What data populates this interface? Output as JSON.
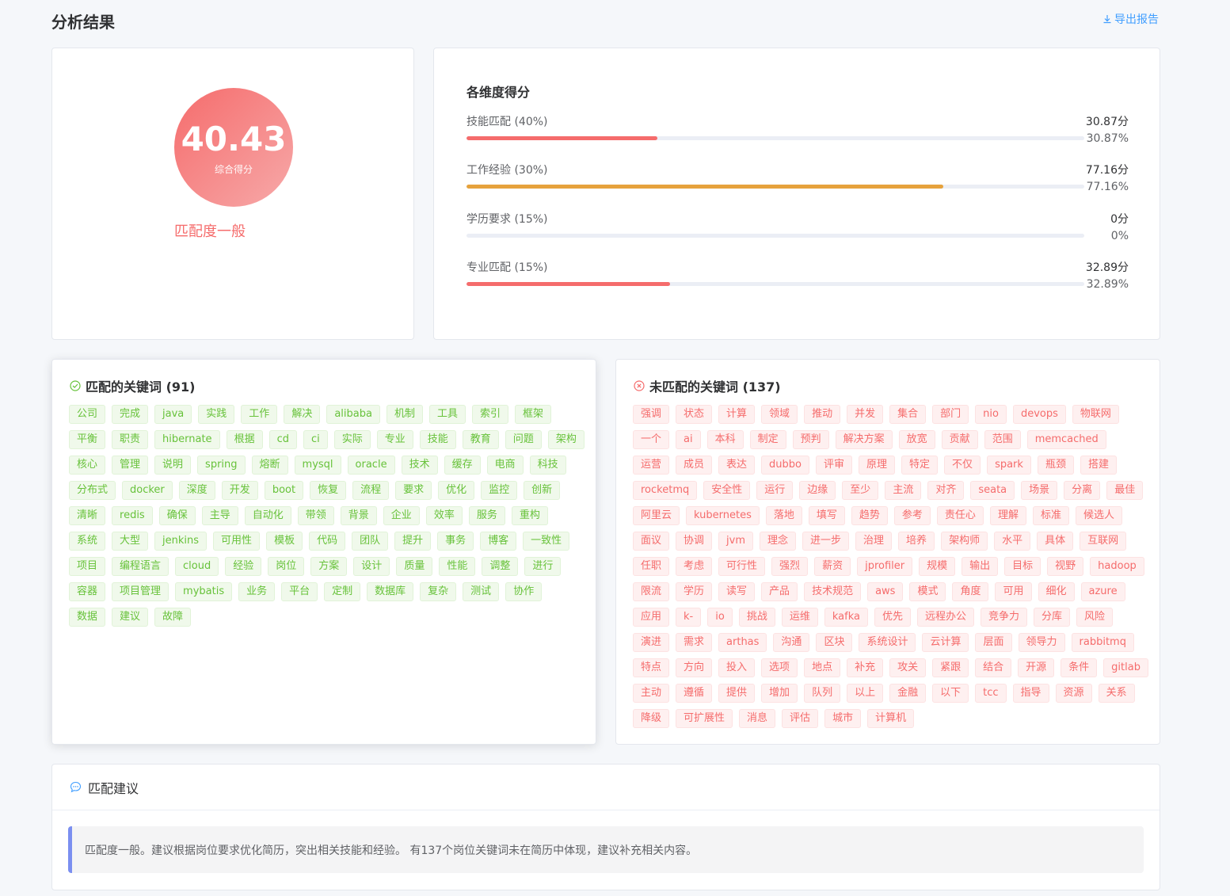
{
  "page": {
    "title": "分析结果",
    "export_label": "导出报告"
  },
  "score": {
    "value": "40.43",
    "label": "综合得分",
    "level": "匹配度一般"
  },
  "dimensions": {
    "title": "各维度得分",
    "items": [
      {
        "name": "技能匹配 (40%)",
        "score": "30.87分",
        "percent_text": "30.87%",
        "percent": 30.87,
        "color": "#f56c6c"
      },
      {
        "name": "工作经验 (30%)",
        "score": "77.16分",
        "percent_text": "77.16%",
        "percent": 77.16,
        "color": "#e6a23c"
      },
      {
        "name": "学历要求 (15%)",
        "score": "0分",
        "percent_text": "0%",
        "percent": 0,
        "color": "#f56c6c"
      },
      {
        "name": "专业匹配 (15%)",
        "score": "32.89分",
        "percent_text": "32.89%",
        "percent": 32.89,
        "color": "#f56c6c"
      }
    ]
  },
  "matched": {
    "title": "匹配的关键词 (91)",
    "keywords": [
      "公司",
      "完成",
      "java",
      "实践",
      "工作",
      "解决",
      "alibaba",
      "机制",
      "工具",
      "索引",
      "框架",
      "平衡",
      "职责",
      "hibernate",
      "根据",
      "cd",
      "ci",
      "实际",
      "专业",
      "技能",
      "教育",
      "问题",
      "架构",
      "核心",
      "管理",
      "说明",
      "spring",
      "熔断",
      "mysql",
      "oracle",
      "技术",
      "缓存",
      "电商",
      "科技",
      "分布式",
      "docker",
      "深度",
      "开发",
      "boot",
      "恢复",
      "流程",
      "要求",
      "优化",
      "监控",
      "创新",
      "清晰",
      "redis",
      "确保",
      "主导",
      "自动化",
      "带领",
      "背景",
      "企业",
      "效率",
      "服务",
      "重构",
      "系统",
      "大型",
      "jenkins",
      "可用性",
      "模板",
      "代码",
      "团队",
      "提升",
      "事务",
      "博客",
      "一致性",
      "项目",
      "编程语言",
      "cloud",
      "经验",
      "岗位",
      "方案",
      "设计",
      "质量",
      "性能",
      "调整",
      "进行",
      "容器",
      "项目管理",
      "mybatis",
      "业务",
      "平台",
      "定制",
      "数据库",
      "复杂",
      "测试",
      "协作",
      "数据",
      "建议",
      "故障"
    ]
  },
  "unmatched": {
    "title": "未匹配的关键词 (137)",
    "keywords": [
      "强调",
      "状态",
      "计算",
      "领域",
      "推动",
      "并发",
      "集合",
      "部门",
      "nio",
      "devops",
      "物联网",
      "一个",
      "ai",
      "本科",
      "制定",
      "预判",
      "解决方案",
      "放宽",
      "贡献",
      "范围",
      "memcached",
      "运营",
      "成员",
      "表达",
      "dubbo",
      "评审",
      "原理",
      "特定",
      "不仅",
      "spark",
      "瓶颈",
      "搭建",
      "rocketmq",
      "安全性",
      "运行",
      "边缘",
      "至少",
      "主流",
      "对齐",
      "seata",
      "场景",
      "分离",
      "最佳",
      "阿里云",
      "kubernetes",
      "落地",
      "填写",
      "趋势",
      "参考",
      "责任心",
      "理解",
      "标准",
      "候选人",
      "面议",
      "协调",
      "jvm",
      "理念",
      "进一步",
      "治理",
      "培养",
      "架构师",
      "水平",
      "具体",
      "互联网",
      "任职",
      "考虑",
      "可行性",
      "强烈",
      "薪资",
      "jprofiler",
      "规模",
      "输出",
      "目标",
      "视野",
      "hadoop",
      "限流",
      "学历",
      "读写",
      "产品",
      "技术规范",
      "aws",
      "模式",
      "角度",
      "可用",
      "细化",
      "azure",
      "应用",
      "k-",
      "io",
      "挑战",
      "运维",
      "kafka",
      "优先",
      "远程办公",
      "竞争力",
      "分库",
      "风险",
      "演进",
      "需求",
      "arthas",
      "沟通",
      "区块",
      "系统设计",
      "云计算",
      "层面",
      "领导力",
      "rabbitmq",
      "特点",
      "方向",
      "投入",
      "选项",
      "地点",
      "补充",
      "攻关",
      "紧跟",
      "结合",
      "开源",
      "条件",
      "gitlab",
      "主动",
      "遵循",
      "提供",
      "增加",
      "队列",
      "以上",
      "金融",
      "以下",
      "tcc",
      "指导",
      "资源",
      "关系",
      "降级",
      "可扩展性",
      "消息",
      "评估",
      "城市",
      "计算机"
    ]
  },
  "suggestion": {
    "title": "匹配建议",
    "text": "匹配度一般。建议根据岗位要求优化简历，突出相关技能和经验。 有137个岗位关键词未在简历中体现，建议补充相关内容。"
  }
}
